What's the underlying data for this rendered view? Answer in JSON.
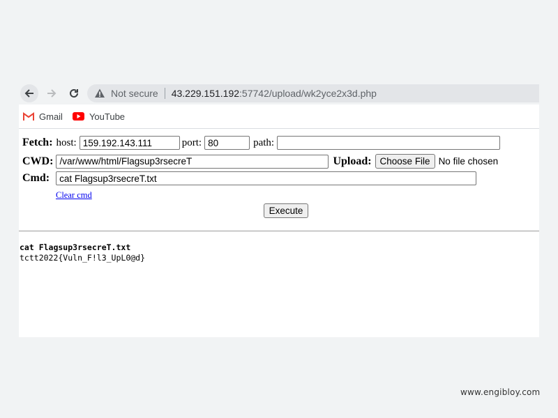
{
  "browser": {
    "security_label": "Not secure",
    "url_host": "43.229.151.192",
    "url_rest": ":57742/upload/wk2yce2x3d.php"
  },
  "bookmarks": [
    {
      "label": "Gmail",
      "icon": "gmail-icon"
    },
    {
      "label": "YouTube",
      "icon": "youtube-icon"
    }
  ],
  "shell": {
    "fetch_label": "Fetch:",
    "host_label": "host:",
    "host_value": "159.192.143.111",
    "port_label": "port:",
    "port_value": "80",
    "path_label": "path:",
    "path_value": "",
    "cwd_label": "CWD:",
    "cwd_value": "/var/www/html/Flagsup3rsecreT",
    "upload_label": "Upload:",
    "choose_file_label": "Choose File",
    "no_file_label": "No file chosen",
    "cmd_label": "Cmd:",
    "cmd_value": "cat Flagsup3rsecreT.txt",
    "clear_cmd_label": "Clear cmd",
    "execute_label": "Execute"
  },
  "output": {
    "command_line": "cat Flagsup3rsecreT.txt",
    "result_line": "tctt2022{Vuln_F!l3_UpL0@d}"
  },
  "watermark": "www.engibloy.com",
  "colors": {
    "page_bg": "#f1f3f4",
    "link": "#0000ee",
    "youtube_red": "#ff0000",
    "gmail_red": "#ea4335"
  }
}
